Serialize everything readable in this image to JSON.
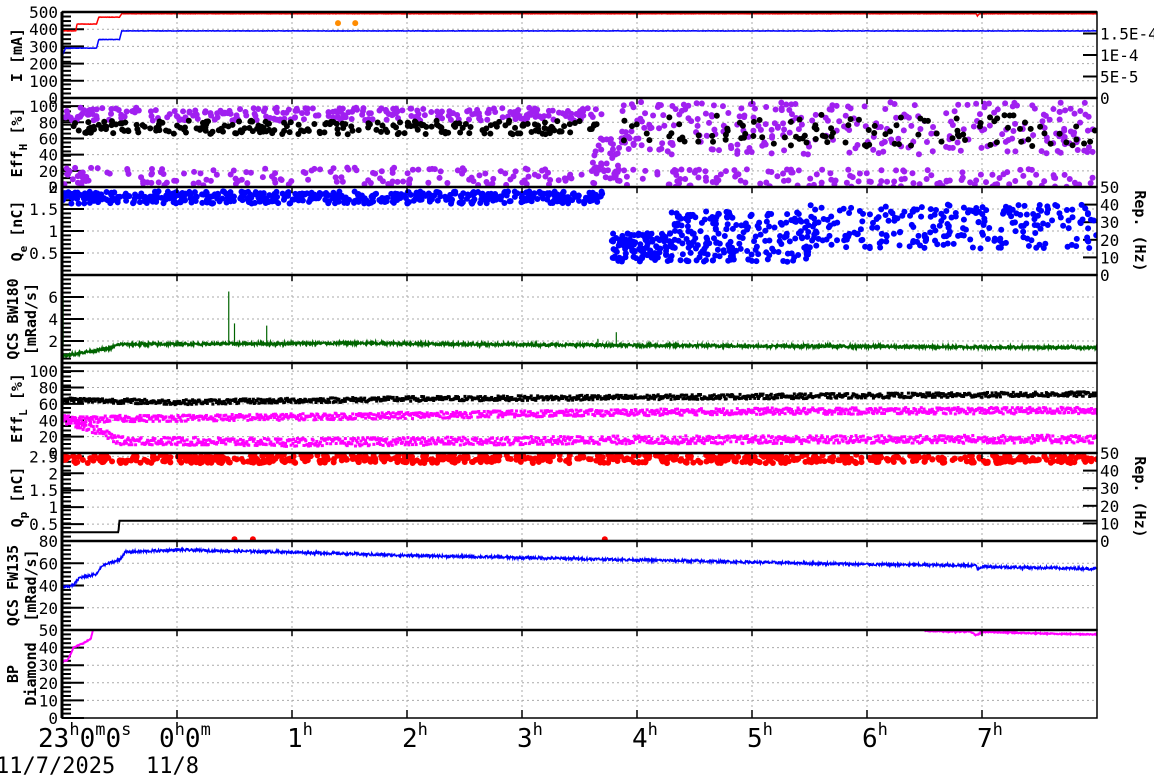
{
  "chart_data": {
    "type": "line",
    "title": "",
    "x_unit": "hours since 23h on 11/7/2025",
    "xlim": [
      0,
      9
    ],
    "x_ticks": [
      {
        "h": "23",
        "m": "0",
        "s": "0"
      },
      {
        "h": "0",
        "m": "0"
      },
      {
        "h": "1"
      },
      {
        "h": "2"
      },
      {
        "h": "3"
      },
      {
        "h": "4"
      },
      {
        "h": "5"
      },
      {
        "h": "6"
      },
      {
        "h": "7"
      }
    ],
    "units": {
      "h": "h",
      "m": "m",
      "s": "s"
    },
    "dates": [
      "11/7/2025",
      "11/8"
    ],
    "panels": [
      {
        "ylabel": [
          "I [mA]"
        ],
        "ylim": [
          0,
          500
        ],
        "yticks": [
          "0",
          "100",
          "200",
          "300",
          "400",
          "500"
        ],
        "right_ylim": [
          0,
          0.0002
        ],
        "right_ticks": [
          "0",
          "5E-5",
          "1E-4",
          "1.5E-4"
        ],
        "series": [
          {
            "name": "I red",
            "kind": "line",
            "color": "#ff0000",
            "noise": 1,
            "points": [
              [
                0,
                390
              ],
              [
                0.12,
                390
              ],
              [
                0.13,
                430
              ],
              [
                0.3,
                430
              ],
              [
                0.32,
                470
              ],
              [
                0.5,
                470
              ],
              [
                0.52,
                490
              ],
              [
                7.95,
                490
              ],
              [
                7.96,
                478
              ],
              [
                7.98,
                490
              ],
              [
                9,
                490
              ]
            ]
          },
          {
            "name": "I blue",
            "kind": "line",
            "color": "#0000ff",
            "noise": 1,
            "points": [
              [
                0,
                240
              ],
              [
                0.03,
                290
              ],
              [
                0.3,
                290
              ],
              [
                0.32,
                340
              ],
              [
                0.5,
                340
              ],
              [
                0.52,
                390
              ],
              [
                9,
                390
              ]
            ]
          },
          {
            "name": "aux orange",
            "kind": "scatter",
            "color": "#ff8c00",
            "right": true,
            "clusters": [
              {
                "t": [
                  2.4,
                  2.4
                ],
                "y": [
                  0.000174,
                  0.000174
                ],
                "n": 1
              },
              {
                "t": [
                  2.55,
                  2.55
                ],
                "y": [
                  0.000174,
                  0.000174
                ],
                "n": 1
              }
            ]
          }
        ]
      },
      {
        "ylabel": [
          "Eff",
          "H",
          " [%]"
        ],
        "ylim": [
          0,
          110
        ],
        "yticks": [
          "0",
          "20",
          "40",
          "60",
          "80",
          "100"
        ],
        "series": [
          {
            "name": "Eff_H purple",
            "kind": "scatter",
            "color": "#a020f0",
            "clusters": [
              {
                "t": [
                  0,
                  4.7
                ],
                "y": [
                  82,
                  98
                ],
                "n": 260
              },
              {
                "t": [
                  0,
                  4.7
                ],
                "y": [
                  2,
                  24
                ],
                "n": 160
              },
              {
                "t": [
                  4.6,
                  4.85
                ],
                "y": [
                  5,
                  60
                ],
                "n": 40
              },
              {
                "t": [
                  4.85,
                  9
                ],
                "y": [
                  40,
                  105
                ],
                "n": 300
              },
              {
                "t": [
                  4.85,
                  9
                ],
                "y": [
                  0,
                  22
                ],
                "n": 140
              }
            ]
          },
          {
            "name": "Eff_H black",
            "kind": "scatter",
            "color": "#000000",
            "clusters": [
              {
                "t": [
                  0.1,
                  4.7
                ],
                "y": [
                  65,
                  82
                ],
                "n": 230
              },
              {
                "t": [
                  4.8,
                  9
                ],
                "y": [
                  50,
                  90
                ],
                "n": 110
              }
            ]
          }
        ]
      },
      {
        "ylabel": [
          "Q",
          "e",
          " [nC]"
        ],
        "ylim": [
          0,
          2
        ],
        "yticks": [
          "0.5",
          "1",
          "1.5",
          "2"
        ],
        "right_label": "Rep. (Hz)",
        "right_ylim": [
          0,
          50
        ],
        "right_ticks": [
          "0",
          "10",
          "20",
          "30",
          "40",
          "50"
        ],
        "series": [
          {
            "name": "Q_e",
            "kind": "scatter",
            "color": "#0000ff",
            "clusters": [
              {
                "t": [
                  0,
                  4.7
                ],
                "y": [
                  1.62,
                  1.9
                ],
                "n": 520
              },
              {
                "t": [
                  4.78,
                  5.3
                ],
                "y": [
                  0.3,
                  0.95
                ],
                "n": 120
              },
              {
                "t": [
                  5.3,
                  6.5
                ],
                "y": [
                  0.3,
                  1.45
                ],
                "n": 200
              },
              {
                "t": [
                  6.5,
                  9
                ],
                "y": [
                  0.6,
                  1.6
                ],
                "n": 240
              }
            ]
          }
        ]
      },
      {
        "ylabel": [
          "QCS BW180",
          "",
          "[mRad/s]"
        ],
        "ylim": [
          0,
          8
        ],
        "yticks": [
          "2",
          "4",
          "6"
        ],
        "series": [
          {
            "name": "QCS BW180",
            "kind": "line",
            "color": "#006400",
            "noise": 0.12,
            "points": [
              [
                0,
                0.6
              ],
              [
                0.2,
                1.0
              ],
              [
                0.4,
                1.3
              ],
              [
                0.5,
                1.7
              ],
              [
                2.5,
                1.8
              ],
              [
                5,
                1.6
              ],
              [
                9,
                1.4
              ]
            ]
          },
          {
            "name": "BW180 spikes",
            "kind": "spikes",
            "color": "#006400",
            "points": [
              [
                0.01,
                6.0
              ],
              [
                1.45,
                6.5
              ],
              [
                1.5,
                3.6
              ],
              [
                1.78,
                3.4
              ],
              [
                4.66,
                2.2
              ],
              [
                4.82,
                2.8
              ]
            ]
          }
        ]
      },
      {
        "ylabel": [
          "Eff",
          "L",
          " [%]"
        ],
        "ylim": [
          0,
          110
        ],
        "yticks": [
          "0",
          "20",
          "40",
          "60",
          "80",
          "100"
        ],
        "series": [
          {
            "name": "Eff_L black",
            "kind": "band",
            "color": "#000000",
            "noise": 3,
            "points": [
              [
                0,
                65
              ],
              [
                1,
                62
              ],
              [
                3,
                66
              ],
              [
                5,
                68
              ],
              [
                7,
                70
              ],
              [
                9,
                72
              ]
            ]
          },
          {
            "name": "Eff_L magenta high",
            "kind": "band",
            "color": "#ff00ff",
            "noise": 4,
            "points": [
              [
                0,
                45
              ],
              [
                0.1,
                40
              ],
              [
                0.5,
                42
              ],
              [
                2,
                44
              ],
              [
                4,
                48
              ],
              [
                6,
                51
              ],
              [
                9,
                52
              ]
            ]
          },
          {
            "name": "Eff_L magenta low",
            "kind": "band",
            "color": "#ff00ff",
            "noise": 5,
            "points": [
              [
                0,
                42
              ],
              [
                0.3,
                28
              ],
              [
                0.5,
                15
              ],
              [
                2,
                13
              ],
              [
                5,
                16
              ],
              [
                9,
                17
              ]
            ]
          }
        ]
      },
      {
        "ylabel": [
          "Q",
          "p",
          " [nC]"
        ],
        "ylim": [
          0,
          2.6
        ],
        "yticks": [
          "0.5",
          "1",
          "1.5",
          "2",
          "2.5"
        ],
        "right_label": "Rep. (Hz)",
        "right_ylim": [
          0,
          50
        ],
        "right_ticks": [
          "0",
          "10",
          "20",
          "30",
          "40",
          "50"
        ],
        "series": [
          {
            "name": "Q_p",
            "kind": "scatter",
            "color": "#ff0000",
            "clusters": [
              {
                "t": [
                  0,
                  9
                ],
                "y": [
                  2.3,
                  2.55
                ],
                "n": 700
              },
              {
                "t": [
                  1.5,
                  1.5
                ],
                "y": [
                  0.05,
                  0.05
                ],
                "n": 1
              },
              {
                "t": [
                  1.66,
                  1.66
                ],
                "y": [
                  0.05,
                  0.05
                ],
                "n": 1
              },
              {
                "t": [
                  4.72,
                  4.72
                ],
                "y": [
                  0.05,
                  0.05
                ],
                "n": 1
              }
            ]
          },
          {
            "name": "Rep rate",
            "kind": "line",
            "color": "#000000",
            "right": true,
            "noise": 0,
            "points": [
              [
                0,
                5
              ],
              [
                0.49,
                5
              ],
              [
                0.5,
                11.5
              ],
              [
                9,
                11.5
              ]
            ]
          }
        ]
      },
      {
        "ylabel": [
          "QCS FW135",
          "",
          "[mRad/s]"
        ],
        "ylim": [
          0,
          80
        ],
        "yticks": [
          "20",
          "40",
          "60",
          "80"
        ],
        "series": [
          {
            "name": "QCS FW135",
            "kind": "line",
            "color": "#0000ff",
            "noise": 1.2,
            "points": [
              [
                0,
                38
              ],
              [
                0.1,
                40
              ],
              [
                0.15,
                47
              ],
              [
                0.3,
                50
              ],
              [
                0.35,
                58
              ],
              [
                0.5,
                63
              ],
              [
                0.55,
                70
              ],
              [
                1,
                72
              ],
              [
                2,
                70
              ],
              [
                3,
                67
              ],
              [
                4,
                65
              ],
              [
                5,
                63
              ],
              [
                6,
                61
              ],
              [
                7,
                59
              ],
              [
                7.95,
                58
              ],
              [
                7.96,
                55
              ],
              [
                8.0,
                57
              ],
              [
                9,
                55
              ]
            ]
          }
        ]
      },
      {
        "ylabel": [
          "BP",
          "",
          "Diamond"
        ],
        "ylim": [
          0,
          50
        ],
        "yticks": [
          "0",
          "10",
          "20",
          "30",
          "40",
          "50"
        ],
        "series": [
          {
            "name": "BP Diamond",
            "kind": "line",
            "color": "#ff00ff",
            "noise": 0.3,
            "points": [
              [
                0,
                32
              ],
              [
                0.05,
                33
              ],
              [
                0.1,
                40
              ],
              [
                0.2,
                43
              ],
              [
                0.25,
                45
              ],
              [
                0.27,
                50
              ]
            ]
          },
          {
            "name": "BP Diamond late",
            "kind": "line",
            "color": "#ff00ff",
            "noise": 0.3,
            "points": [
              [
                7.5,
                49.5
              ],
              [
                7.9,
                49
              ],
              [
                7.95,
                47
              ],
              [
                8.0,
                49
              ],
              [
                8.5,
                48
              ],
              [
                9,
                47.5
              ]
            ]
          }
        ]
      }
    ]
  }
}
